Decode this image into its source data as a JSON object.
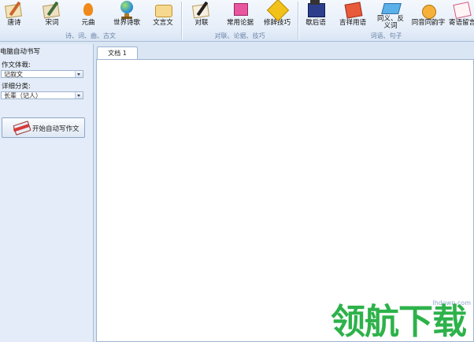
{
  "ribbon": {
    "tools": [
      {
        "label": "唐诗",
        "icon": "tang-poetry-icon"
      },
      {
        "label": "宋词",
        "icon": "song-ci-icon"
      },
      {
        "label": "元曲",
        "icon": "yuan-qu-icon"
      },
      {
        "label": "世界诗歌",
        "icon": "world-poetry-icon"
      },
      {
        "label": "文言文",
        "icon": "classical-chinese-icon"
      },
      {
        "label": "对联",
        "icon": "couplet-icon"
      },
      {
        "label": "常用论据",
        "icon": "common-arguments-icon"
      },
      {
        "label": "修辞技巧",
        "icon": "rhetoric-icon"
      },
      {
        "label": "歇后语",
        "icon": "xiehouyu-icon"
      },
      {
        "label": "吉祥用语",
        "icon": "auspicious-phrases-icon"
      },
      {
        "label": "同义、反义词",
        "icon": "synonym-antonym-icon"
      },
      {
        "label": "同音同韵字",
        "icon": "homophone-icon"
      },
      {
        "label": "寄语留言",
        "icon": "message-icon"
      }
    ],
    "groups": {
      "g1": "诗、词、曲、古文",
      "g2": "对联、论据、技巧",
      "g3": "词语、句子"
    }
  },
  "panel": {
    "title": "电脑自动书写",
    "genre_label": "作文体裁:",
    "genre_value": "记叙文",
    "subtype_label": "详细分类:",
    "subtype_value": "长辈（记人）",
    "start_button": "开始自动写作文"
  },
  "document": {
    "tab": "文档 1"
  },
  "watermark": {
    "text": "领航下载",
    "url": "lhdown.com"
  }
}
